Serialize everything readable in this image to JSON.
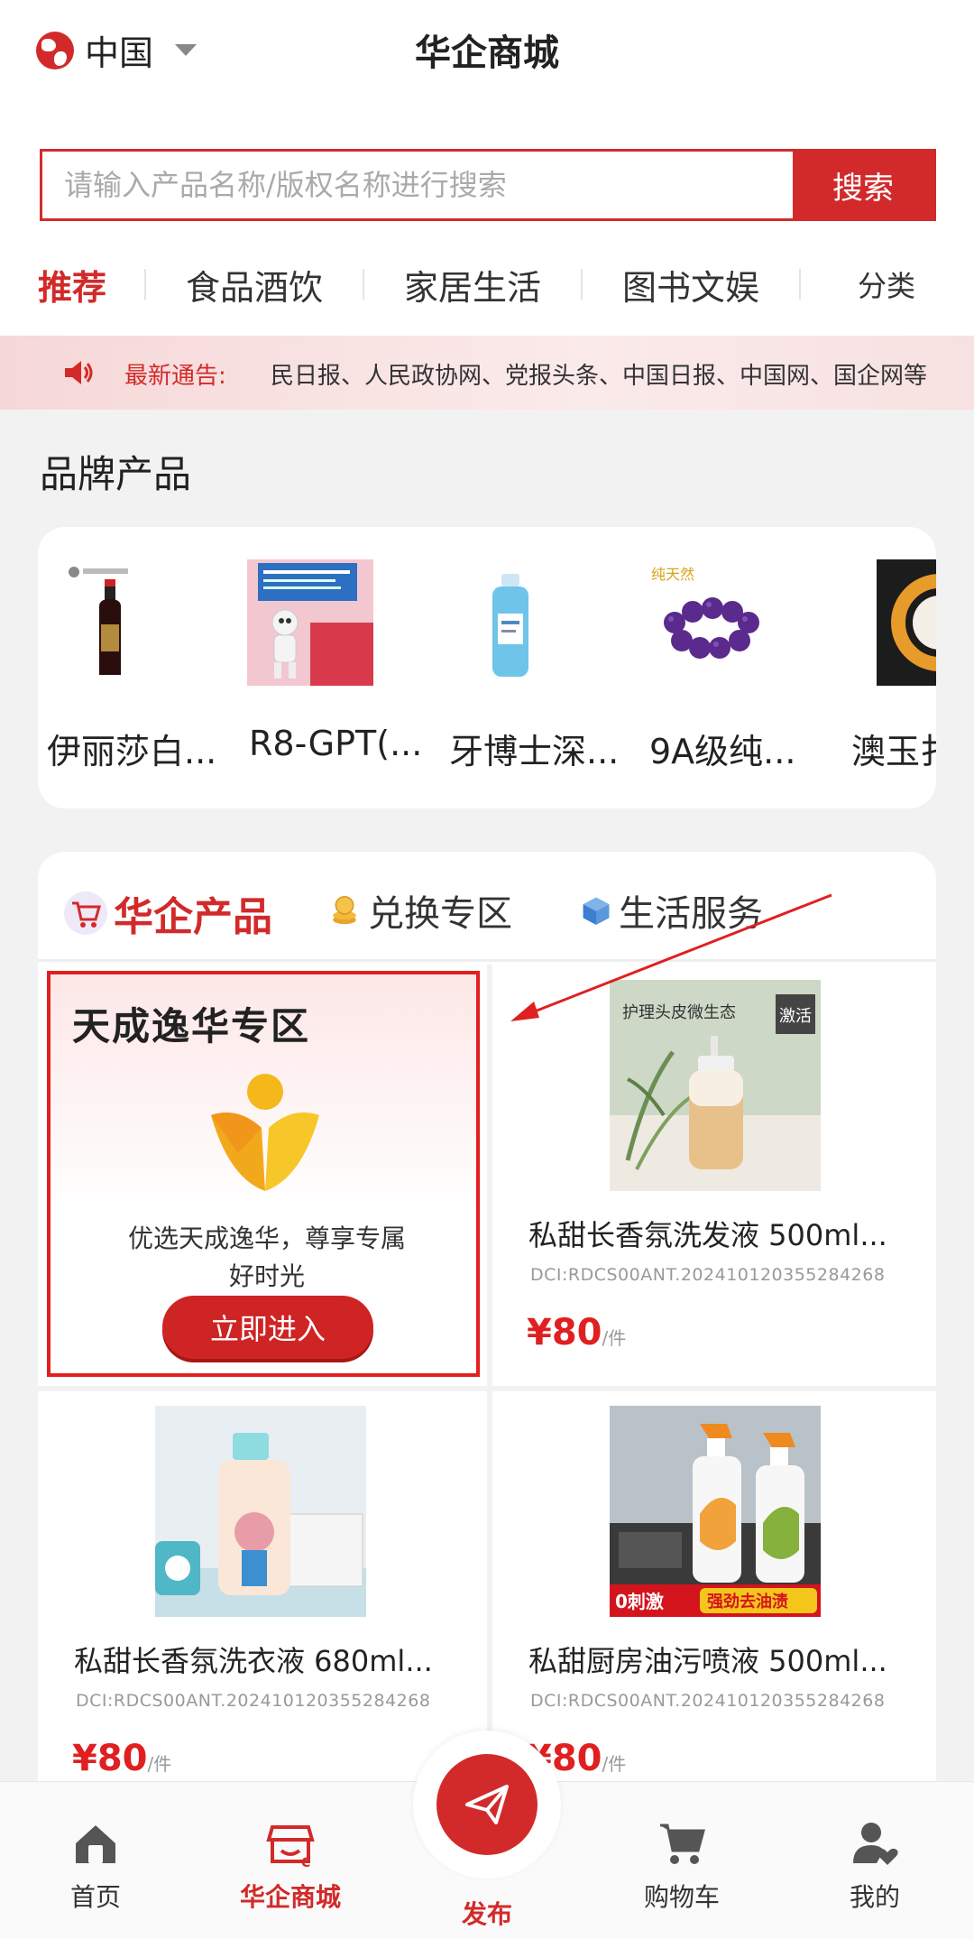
{
  "header": {
    "region": "中国",
    "title": "华企商城",
    "search_placeholder": "请输入产品名称/版权名称进行搜索",
    "search_button": "搜索"
  },
  "categories": [
    "推荐",
    "食品酒饮",
    "家居生活",
    "图书文娱",
    "分类"
  ],
  "notice": {
    "label": "最新通告:",
    "text": "民日报、人民政协网、党报头条、中国日报、中国网、国企网等"
  },
  "brand_section": {
    "title": "品牌产品",
    "items": [
      "伊丽莎白...",
      "R8-GPT(...",
      "牙博士深...",
      "9A级纯...",
      "澳玉扌"
    ]
  },
  "product_tabs": [
    "华企产品",
    "兑换专区",
    "生活服务"
  ],
  "promo": {
    "title": "天成逸华专区",
    "desc_line1": "优选天成逸华，尊享专属",
    "desc_line2": "好时光",
    "button": "立即进入"
  },
  "products": [
    {
      "name": "私甜长香氛洗发液 500ml...",
      "dci": "DCI:RDCS00ANT.20241012035528426​8",
      "price": "¥80",
      "unit": "/件",
      "badge": "激活"
    },
    {
      "name": "私甜长香氛洗衣液 680ml...",
      "dci": "DCI:RDCS00ANT.202410120355284268",
      "price": "¥80",
      "unit": "/件"
    },
    {
      "name": "私甜厨房油污喷液 500ml...",
      "dci": "DCI:RDCS00ANT.202410120355284268",
      "price": "¥80",
      "unit": "/件",
      "badge_left": "0刺激",
      "badge_right": "强劲去油渍"
    }
  ],
  "product_image_texts": {
    "shampoo_label": "护理头皮微生态",
    "bracelet_label": "纯天然"
  },
  "bottom_nav": {
    "home": "首页",
    "mall": "华企商城",
    "publish": "发布",
    "cart": "购物车",
    "mine": "我的"
  },
  "colors": {
    "brand_red": "#d22a2a",
    "price_red": "#e02020"
  }
}
